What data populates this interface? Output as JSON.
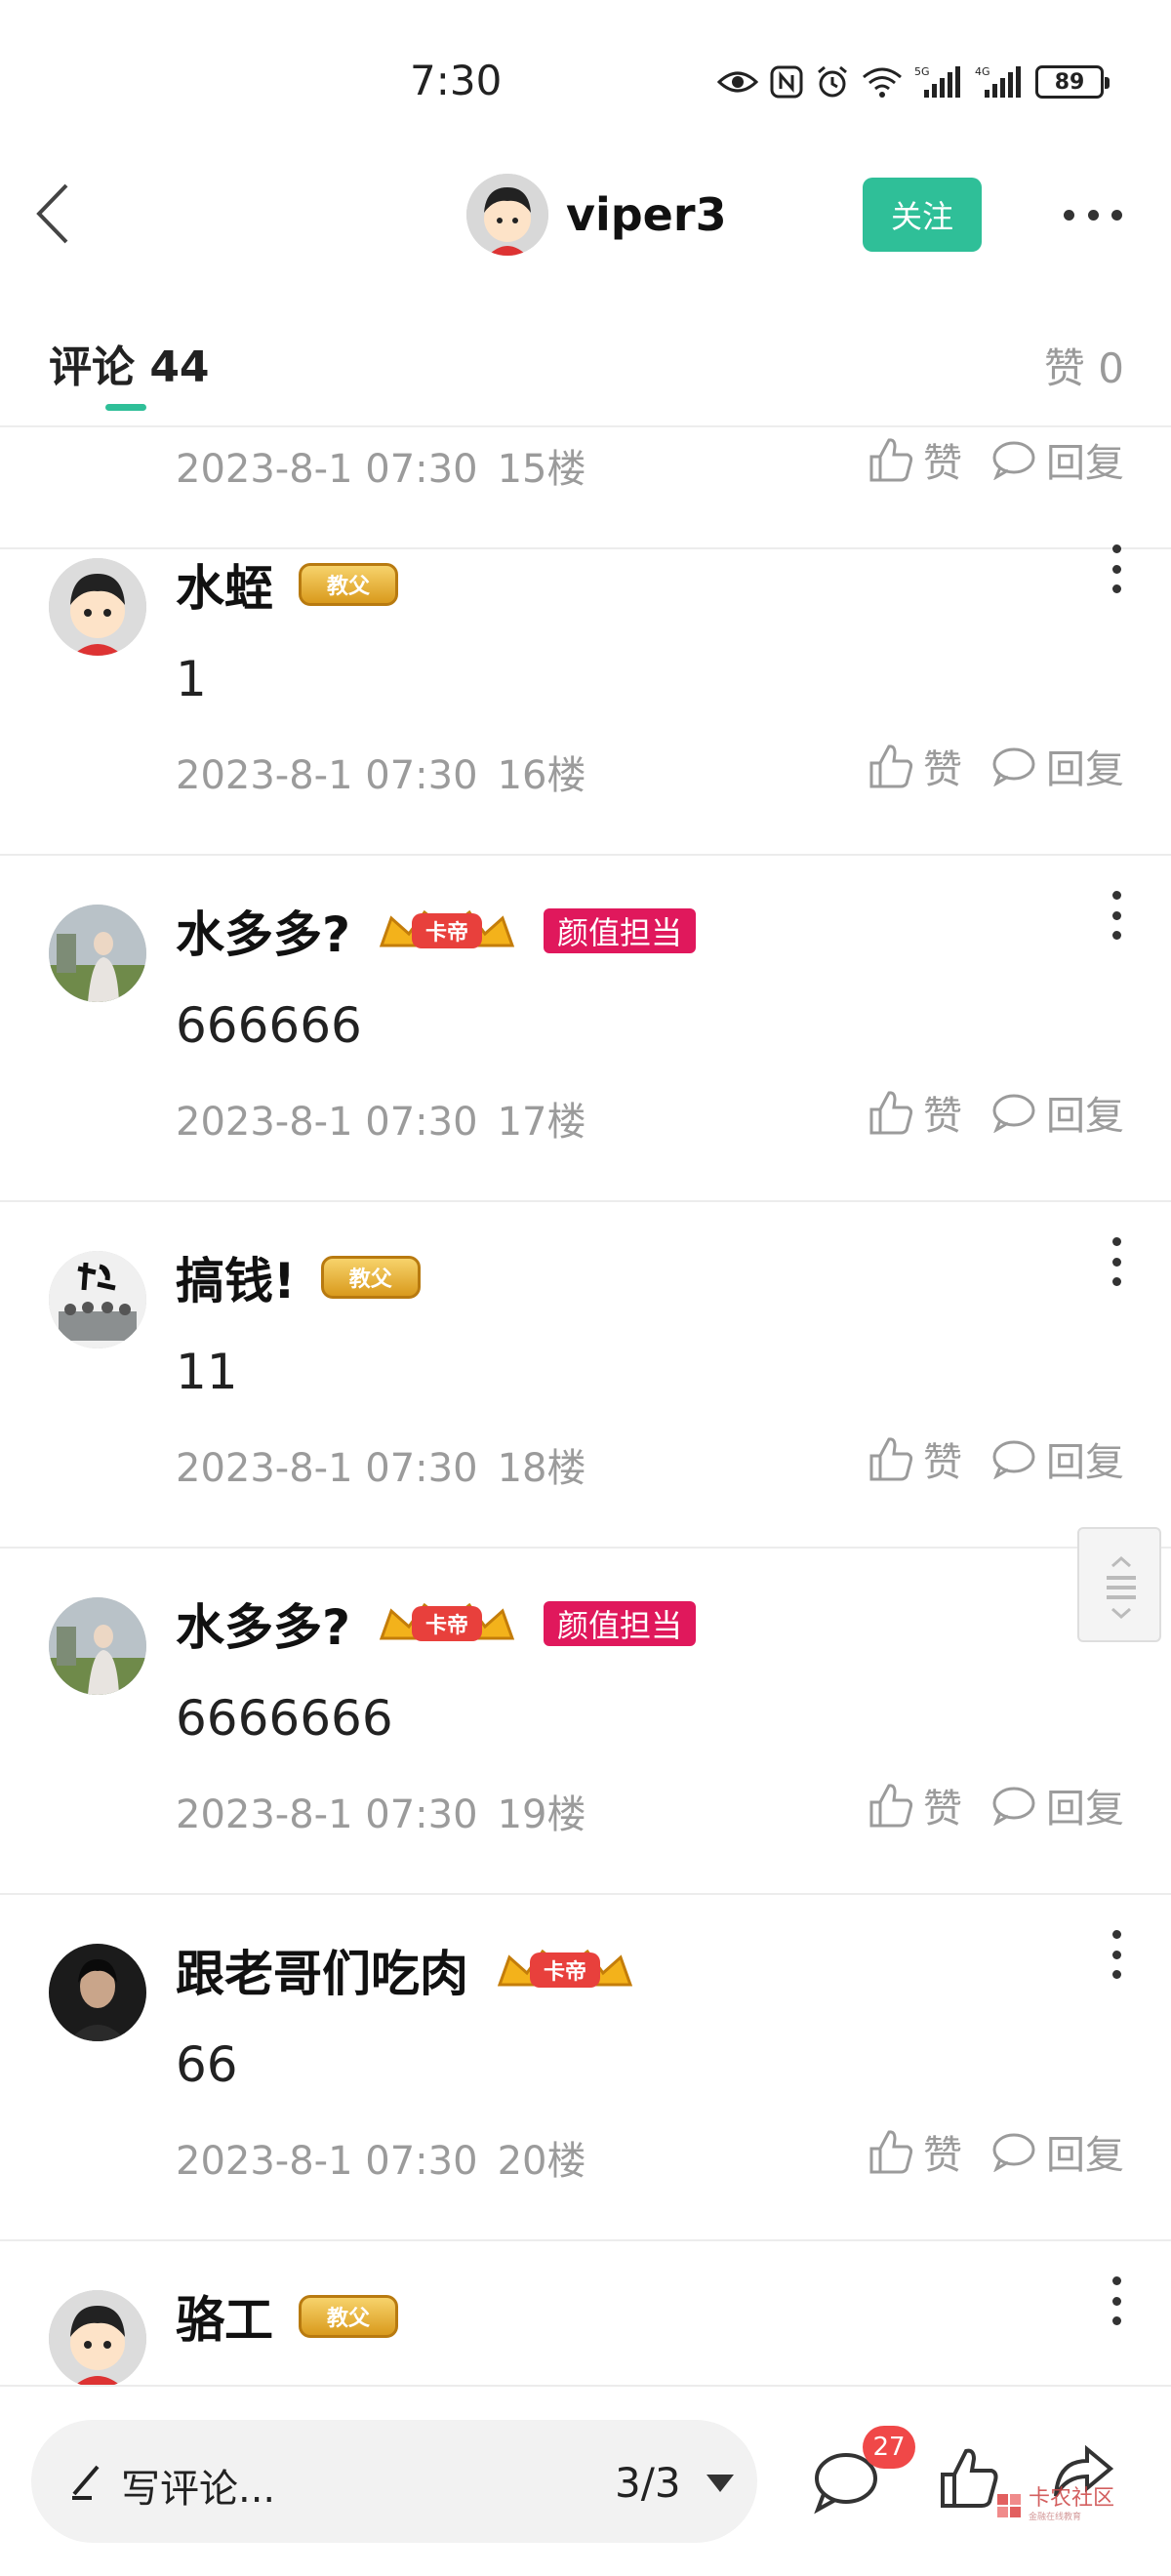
{
  "status_bar": {
    "time": "7:30",
    "network_labels": [
      "5G",
      "4G"
    ],
    "battery": "89"
  },
  "header": {
    "username": "viper3",
    "follow_label": "关注"
  },
  "tabs": {
    "comments_label": "评论 44",
    "likes_label": "赞 0"
  },
  "comments": [
    {
      "name": "",
      "text": "",
      "date": "2023-8-1 07:30",
      "floor": "15楼",
      "like_label": "赞",
      "reply_label": "回复",
      "badge": null,
      "tag": null,
      "avatar": "cartoon-avatar"
    },
    {
      "name": "水蛭",
      "text": "1",
      "date": "2023-8-1 07:30",
      "floor": "16楼",
      "like_label": "赞",
      "reply_label": "回复",
      "badge": "教父",
      "tag": null,
      "avatar": "cartoon-avatar"
    },
    {
      "name": "水多多?",
      "text": "666666",
      "date": "2023-8-1 07:30",
      "floor": "17楼",
      "like_label": "赞",
      "reply_label": "回复",
      "badge": "卡帝",
      "tag": "颜值担当",
      "avatar": "photo-avatar"
    },
    {
      "name": "搞钱!",
      "text": "11",
      "date": "2023-8-1 07:30",
      "floor": "18楼",
      "like_label": "赞",
      "reply_label": "回复",
      "badge": "教父",
      "tag": null,
      "avatar": "calligraphy-avatar"
    },
    {
      "name": "水多多?",
      "text": "6666666",
      "date": "2023-8-1 07:30",
      "floor": "19楼",
      "like_label": "赞",
      "reply_label": "回复",
      "badge": "卡帝",
      "tag": "颜值担当",
      "avatar": "photo-avatar"
    },
    {
      "name": "跟老哥们吃肉",
      "text": "66",
      "date": "2023-8-1 07:30",
      "floor": "20楼",
      "like_label": "赞",
      "reply_label": "回复",
      "badge": "卡帝",
      "tag": null,
      "avatar": "dark-photo-avatar"
    },
    {
      "name": "骆工",
      "text": "",
      "date": "",
      "floor": "",
      "like_label": "",
      "reply_label": "",
      "badge": "教父",
      "tag": null,
      "avatar": "cartoon-avatar"
    }
  ],
  "bottom_bar": {
    "input_placeholder": "写评论...",
    "page_indicator": "3/3",
    "comment_count_badge": "27",
    "watermark_text": "卡农社区",
    "watermark_sub": "金融在线教育"
  },
  "colors": {
    "accent": "#2fbf98",
    "tag_pink": "#e0185c",
    "badge_red": "#f04848",
    "meta_gray": "#9b9b9b"
  }
}
